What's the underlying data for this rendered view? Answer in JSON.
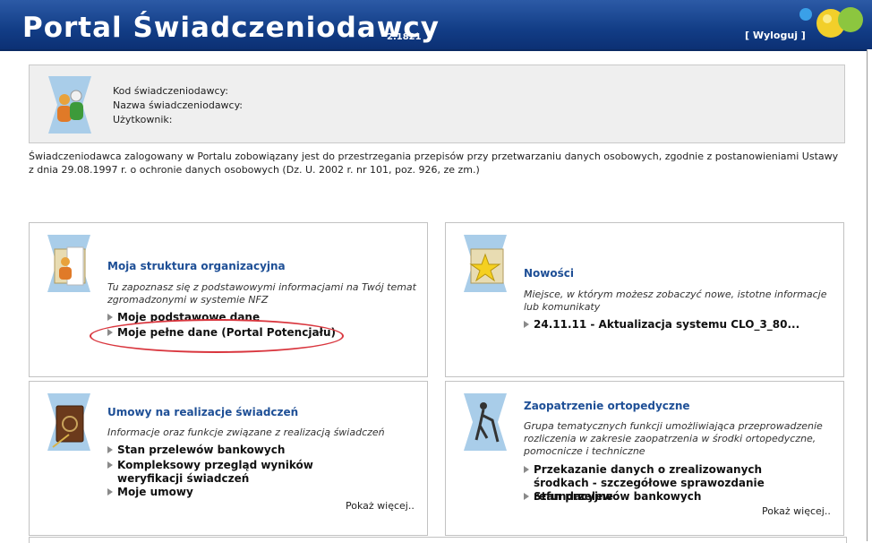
{
  "header": {
    "title": "Portal Świadczeniodawcy",
    "version": "2.1821",
    "logout": "[ Wyloguj ]"
  },
  "info": {
    "code_label": "Kod świadczeniodawcy:",
    "name_label": "Nazwa świadczeniodawcy:",
    "user_label": "Użytkownik:"
  },
  "notice": "Świadczeniodawca zalogowany w Portalu zobowiązany jest do przestrzegania przepisów przy przetwarzaniu danych osobowych, zgodnie z postanowieniami Ustawy z dnia 29.08.1997 r. o ochronie danych osobowych (Dz. U. 2002 r. nr 101, poz. 926, ze zm.)",
  "panels": {
    "struktura": {
      "title": "Moja struktura organizacyjna",
      "desc": "Tu zapoznasz się z podstawowymi informacjami na Twój temat zgromadzonymi w systemie NFZ",
      "links": [
        "Moje podstawowe dane",
        "Moje pełne dane (Portal Potencjału)"
      ]
    },
    "nowosci": {
      "title": "Nowości",
      "desc": "Miejsce, w którym możesz zobaczyć nowe, istotne informacje lub komunikaty",
      "links": [
        "24.11.11 - Aktualizacja systemu CLO_3_80..."
      ]
    },
    "umowy": {
      "title": "Umowy na realizacje świadczeń",
      "desc": "Informacje oraz funkcje związane z realizacją świadczeń",
      "links": [
        "Stan przelewów bankowych",
        "Kompleksowy przegląd wyników weryfikacji świadczeń",
        "Moje umowy"
      ],
      "more": "Pokaż więcej.."
    },
    "zaopatrzenie": {
      "title": "Zaopatrzenie ortopedyczne",
      "desc": "Grupa tematycznych funkcji umożliwiająca przeprowadzenie rozliczenia w zakresie zaopatrzenia w środki ortopedyczne, pomocnicze i techniczne",
      "links": [
        "Przekazanie danych o zrealizowanych środkach - szczegółowe sprawozdanie refundacyjne",
        "Stan przelewów bankowych"
      ],
      "more": "Pokaż więcej.."
    }
  },
  "icons": {
    "info": "users-icon",
    "struktura": "folder-user-icon",
    "nowosci": "star-folder-icon",
    "umowy": "contract-book-icon",
    "zaopatrzenie": "crutch-icon"
  },
  "colors": {
    "header": "#123d86",
    "panel_title": "#1e4f96",
    "highlight_oval": "#d9363e"
  }
}
